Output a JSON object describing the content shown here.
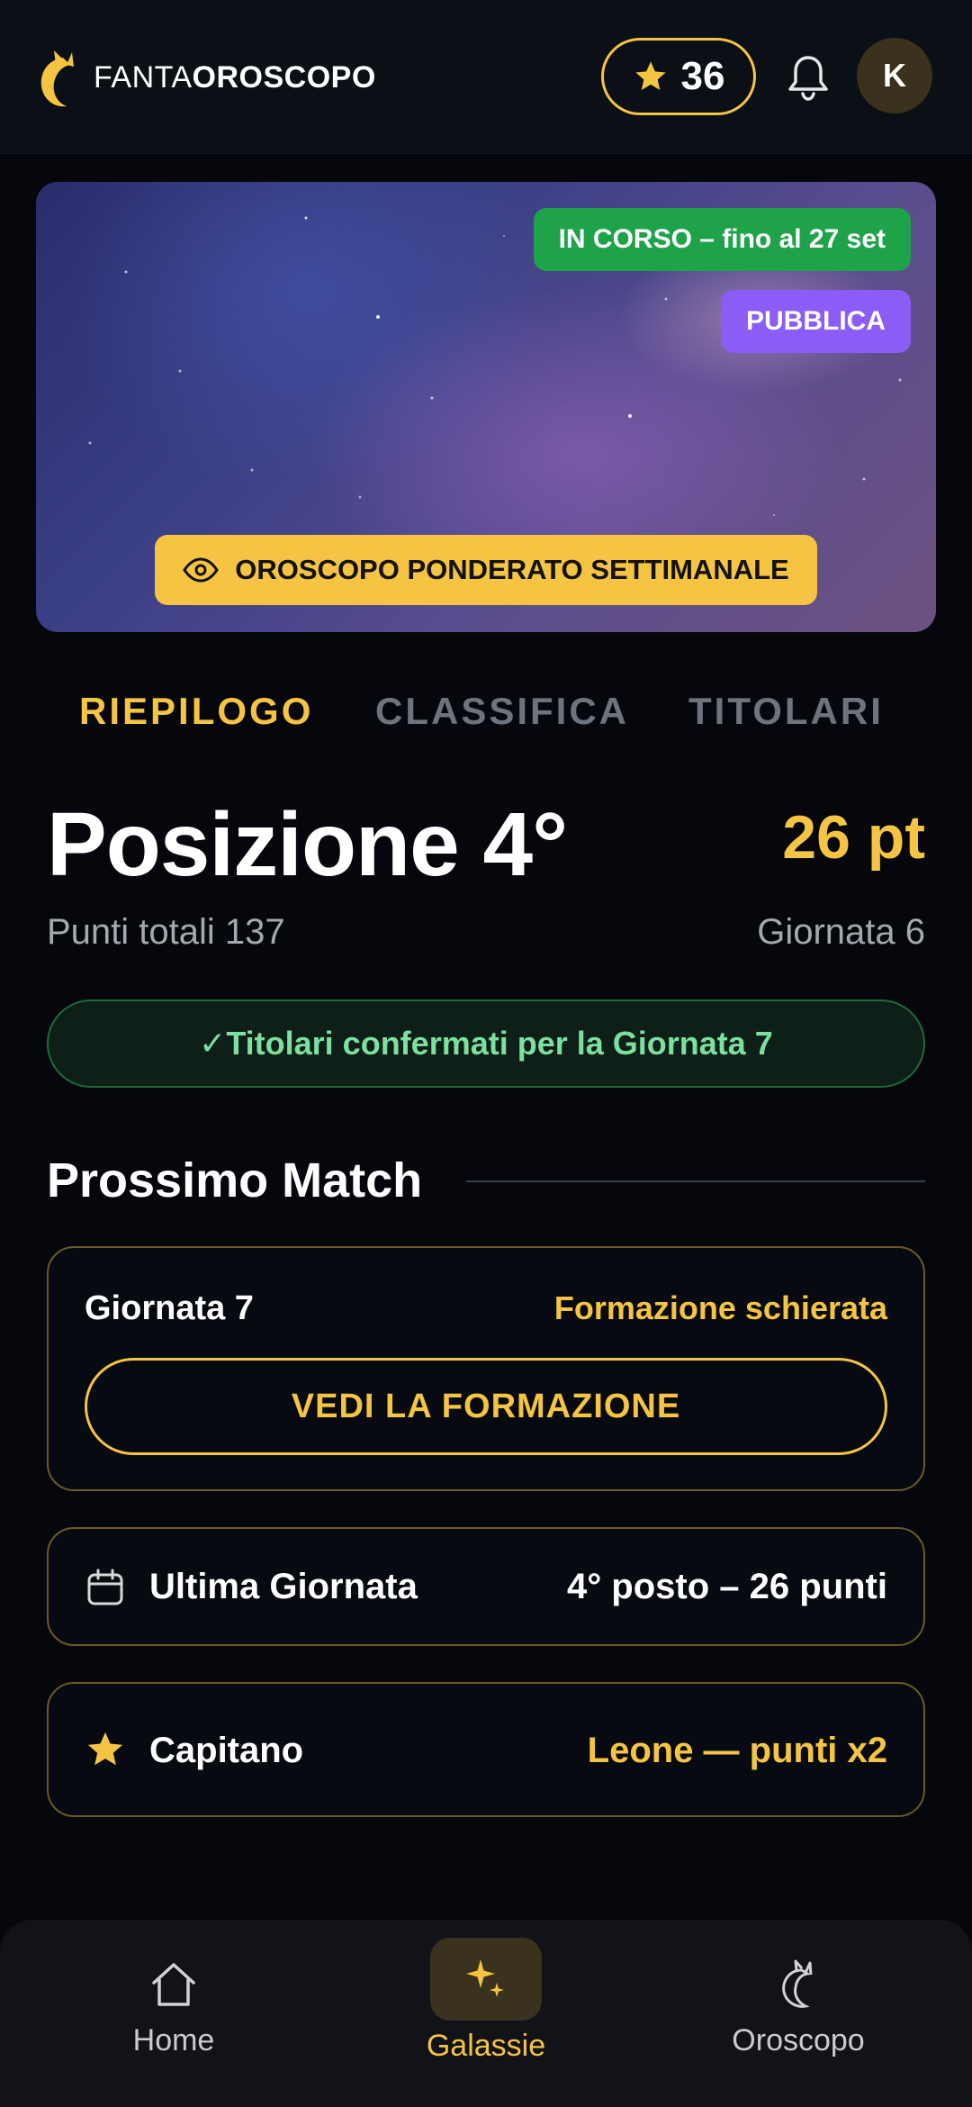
{
  "header": {
    "logo_part1": "FANTA",
    "logo_part2": "OROSCOPO",
    "stars_count": "36",
    "avatar_initial": "K"
  },
  "hero": {
    "status_badge": "IN CORSO – fino al 27 set",
    "visibility_badge": "PUBBLICA",
    "cta_label": "OROSCOPO PONDERATO SETTIMANALE"
  },
  "tabs": [
    {
      "label": "RIEPILOGO",
      "active": true
    },
    {
      "label": "CLASSIFICA",
      "active": false
    },
    {
      "label": "TITOLARI",
      "active": false
    }
  ],
  "summary": {
    "position_title": "Posizione 4°",
    "points": "26 pt",
    "total_points": "Punti totali 137",
    "matchday": "Giornata 6",
    "confirmation": "✓Titolari confermati per la Giornata 7"
  },
  "next_match": {
    "section_title": "Prossimo Match",
    "matchday_label": "Giornata 7",
    "formation_state": "Formazione schierata",
    "button_label": "VEDI LA FORMAZIONE"
  },
  "last_matchday": {
    "label": "Ultima Giornata",
    "value": "4° posto – 26 punti"
  },
  "captain": {
    "label": "Capitano",
    "value": "Leone — punti x2"
  },
  "bottom_nav": [
    {
      "label": "Home",
      "icon": "home-icon",
      "active": false
    },
    {
      "label": "Galassie",
      "icon": "sparkles-icon",
      "active": true
    },
    {
      "label": "Oroscopo",
      "icon": "zodiac-icon",
      "active": false
    }
  ],
  "colors": {
    "accent": "#f5c443",
    "background": "#05070c",
    "success": "#1fa34a",
    "public_badge": "#8b5cf6"
  }
}
